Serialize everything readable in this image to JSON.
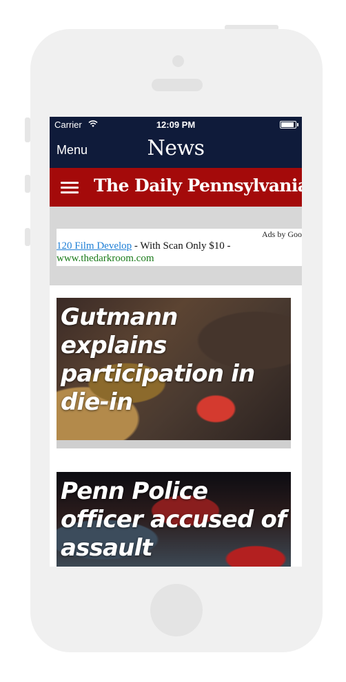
{
  "status_bar": {
    "carrier": "Carrier",
    "time": "12:09 PM",
    "wifi_icon": "wifi-icon",
    "battery_level": 1.0
  },
  "nav": {
    "menu_label": "Menu",
    "title": "News"
  },
  "brand": {
    "name": "The Daily Pennsylvanian",
    "icon": "hamburger-menu-icon"
  },
  "ad": {
    "ads_by": "Ads by Goog",
    "link_text": "120 Film Develop",
    "description": " - With Scan Only $10 -",
    "url": "www.thedarkroom.com"
  },
  "articles": [
    {
      "title": "Gutmann explains participation in die-in"
    },
    {
      "title": "Penn Police officer accused of assault"
    }
  ],
  "colors": {
    "navbar": "#0f1b3a",
    "brandbar": "#a40a0a",
    "ad_link": "#1e7fd6",
    "ad_url": "#1a7b1a"
  }
}
